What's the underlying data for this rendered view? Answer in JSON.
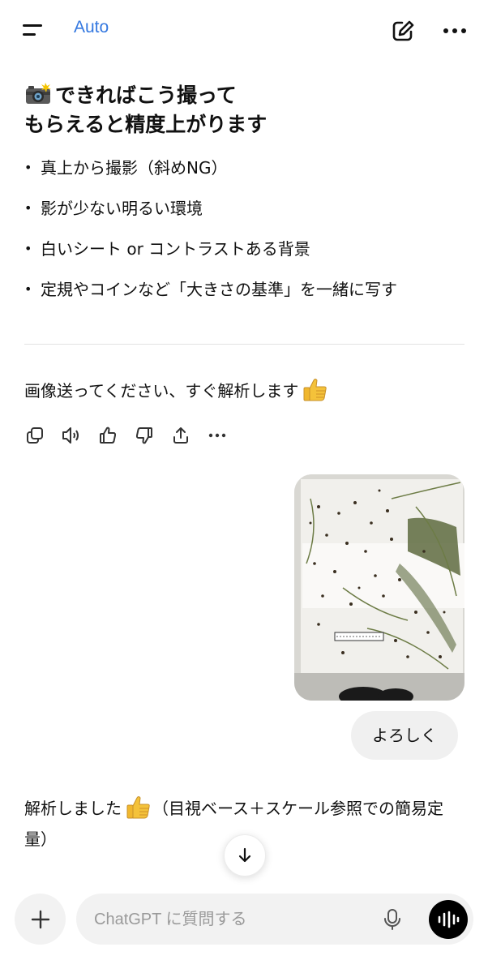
{
  "header": {
    "model_label": "Auto",
    "icons": {
      "menu": "menu-icon",
      "edit": "new-chat-icon",
      "more": "more-icon"
    }
  },
  "assistant_msg1": {
    "heading_line1": "できればこう撮って",
    "heading_line2": "もらえると精度上がります",
    "heading_emoji": "camera-flash-icon",
    "bullets": [
      "真上から撮影（斜めNG）",
      "影が少ない明るい環境",
      "白いシート or コントラストある背景",
      "定規やコインなど「大きさの基準」を一緒に写す"
    ]
  },
  "assistant_msg2": {
    "text": "画像送ってください、すぐ解析します",
    "emoji": "thumbs-up-icon"
  },
  "action_bar": {
    "icons": [
      "copy-icon",
      "read-aloud-icon",
      "thumbs-up-icon",
      "thumbs-down-icon",
      "share-icon",
      "more-icon"
    ]
  },
  "user_msg": {
    "image": "photo-of-seeds-and-grass-on-white-sheet",
    "text": "よろしく"
  },
  "assistant_msg3": {
    "prefix": "解析しました",
    "emoji": "thumbs-up-icon",
    "suffix": "（目視ベース＋スケール参照での簡易定量）"
  },
  "composer": {
    "placeholder": "ChatGPT に質問する",
    "icons": {
      "plus": "plus-icon",
      "mic": "mic-icon",
      "voice": "voice-mode-icon",
      "scroll": "arrow-down-icon"
    }
  },
  "colors": {
    "accent": "#3478e0",
    "bubble": "#f0f0f0",
    "composer": "#f2f2f2"
  }
}
